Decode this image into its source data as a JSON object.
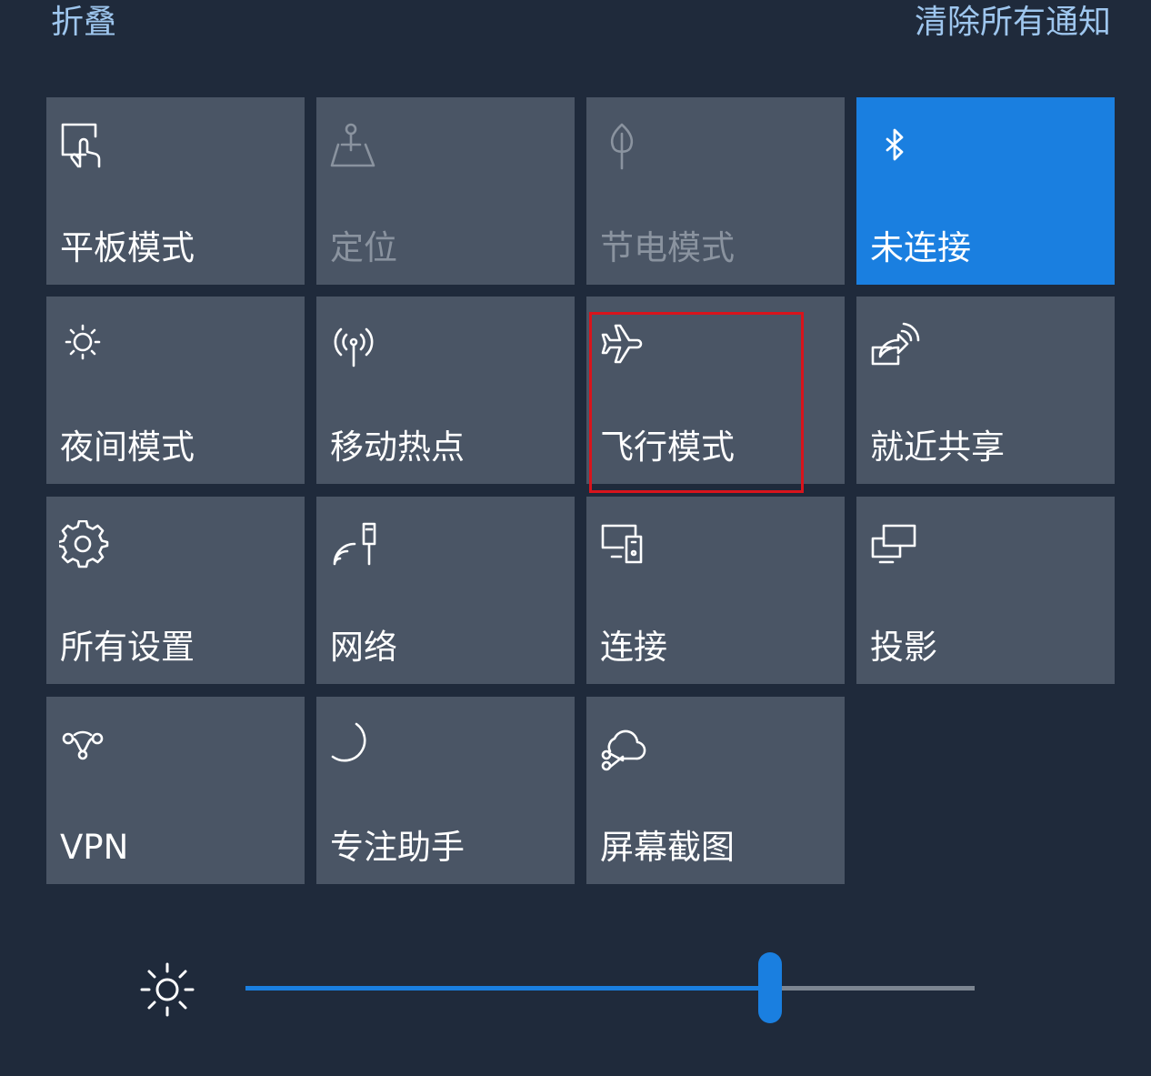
{
  "header": {
    "collapse_label": "折叠",
    "clear_all_label": "清除所有通知"
  },
  "tiles": [
    {
      "label": "平板模式",
      "icon": "tablet-mode-icon",
      "state": "off"
    },
    {
      "label": "定位",
      "icon": "location-icon",
      "state": "disabled"
    },
    {
      "label": "节电模式",
      "icon": "battery-saver-icon",
      "state": "disabled"
    },
    {
      "label": "未连接",
      "icon": "bluetooth-icon",
      "state": "on"
    },
    {
      "label": "夜间模式",
      "icon": "night-light-icon",
      "state": "off"
    },
    {
      "label": "移动热点",
      "icon": "mobile-hotspot-icon",
      "state": "off"
    },
    {
      "label": "飞行模式",
      "icon": "airplane-icon",
      "state": "off"
    },
    {
      "label": "就近共享",
      "icon": "nearby-share-icon",
      "state": "off"
    },
    {
      "label": "所有设置",
      "icon": "gear-icon",
      "state": "off"
    },
    {
      "label": "网络",
      "icon": "network-icon",
      "state": "off"
    },
    {
      "label": "连接",
      "icon": "connect-icon",
      "state": "off"
    },
    {
      "label": "投影",
      "icon": "project-icon",
      "state": "off"
    },
    {
      "label": "VPN",
      "icon": "vpn-icon",
      "state": "off"
    },
    {
      "label": "专注助手",
      "icon": "moon-icon",
      "state": "off"
    },
    {
      "label": "屏幕截图",
      "icon": "screen-snip-icon",
      "state": "off"
    }
  ],
  "highlighted_tile": "飞行模式",
  "brightness": {
    "icon": "brightness-icon",
    "level_fraction": 0.72
  },
  "colors": {
    "accent": "#1a7fe0",
    "tile": "#4a5565",
    "background": "#1f2a3b",
    "header_link": "#9ec6ee",
    "highlight_box": "#d8141c"
  }
}
